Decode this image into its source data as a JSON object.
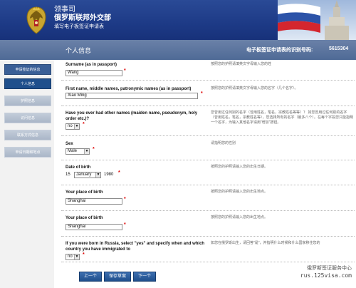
{
  "header": {
    "line1": "领事司",
    "line2": "俄罗斯联邦外交部",
    "line3": "填写电子板签证申请表"
  },
  "subbar": {
    "section_title": "个人信息",
    "app_number_label": "电子板签证申请表的识别号码:",
    "app_number": "5615304"
  },
  "sidebar": {
    "items": [
      {
        "label": "申请签证的信息",
        "state": "done"
      },
      {
        "label": "个人信息",
        "state": "active"
      },
      {
        "label": "护照信息",
        "state": "pending"
      },
      {
        "label": "访问信息",
        "state": "pending"
      },
      {
        "label": "联系方式信息",
        "state": "pending"
      },
      {
        "label": "申请日期和地点",
        "state": "pending"
      }
    ]
  },
  "form": {
    "surname": {
      "label": "Surname (as in passport)",
      "value": "Wang",
      "hint": "按照您的护照请填英文字母输入您的姓"
    },
    "given": {
      "label": "First name, middle names, patronymic names (as in passport)",
      "value": "Xiao Ming",
      "hint": "按照您的护照请填英文字母输入您的名字（几个名字）。"
    },
    "other_names": {
      "label": "Have you ever had other names (maiden name, pseudonym, holy order etc.)?",
      "value": "no",
      "hint": "您曾用过任何别的名字（曾用姓名，笔名，宗教姓名等等）？  如您曾用过任何别的名字（曾用姓名，笔名，宗教姓名等），您选择所有的名字（最多八个）。在每个字段您只能指明一个名字，为输入其他名字请用“增加”按钮。"
    },
    "sex": {
      "label": "Sex",
      "value": "Male",
      "hint": "请指明您的性别"
    },
    "dob": {
      "label": "Date of birth",
      "day": "15",
      "month": "January",
      "year": "1980",
      "hint": "按照您的护照请输入您的出生日期。"
    },
    "pob1": {
      "label": "Your place of birth",
      "value": "Shanghai",
      "hint": "按照您的护照请输入您的出生地点。"
    },
    "pob2": {
      "label": "Your place of birth",
      "value": "Shanghai",
      "hint": "按照您的护照请输入您的出生地点。"
    },
    "russia": {
      "label": "If you were born in Russia, select \"yes\" and specify when and which country you have immigrated to",
      "value": "no",
      "hint": "如您在俄罗斯出生，请回答\"是\"，并指明什么时候和什么国家移住您的"
    }
  },
  "buttons": {
    "prev": "上一个",
    "save": "保存草案",
    "next": "下一个"
  },
  "watermark": {
    "line1": "俄罗斯签证服务中心",
    "line2": "rus.125visa.com"
  },
  "colors": {
    "header_blue": "#1d3a86",
    "nav_active": "#1f4f8c",
    "required": "#dd0000"
  }
}
